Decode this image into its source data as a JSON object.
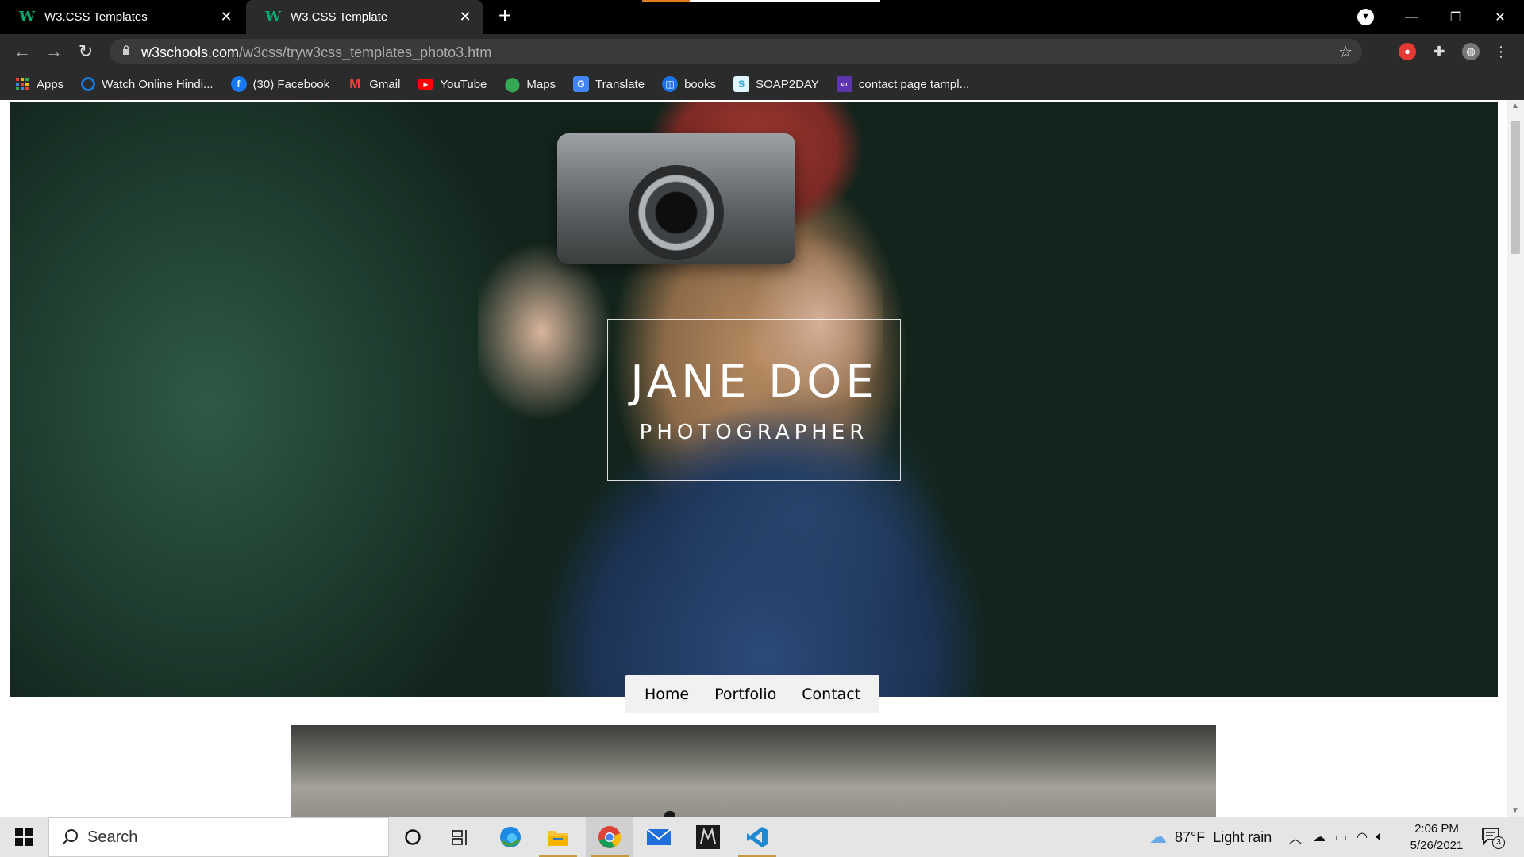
{
  "tabs": [
    {
      "label": "W3.CSS Templates",
      "favicon": "W",
      "close": "✕"
    },
    {
      "label": "W3.CSS Template",
      "favicon": "W",
      "close": "✕"
    }
  ],
  "new_tab": "+",
  "window_controls": {
    "minimize": "—",
    "restore": "❐",
    "close": "✕"
  },
  "toolbar": {
    "url_host": "w3schools.com",
    "url_path": "/w3css/tryw3css_templates_photo3.htm"
  },
  "bookmarks": [
    {
      "label": "Apps",
      "icon": "apps-grid-icon",
      "color": "#ea4335"
    },
    {
      "label": "Watch Online Hindi...",
      "icon": "circle-icon",
      "color": "#1976d2"
    },
    {
      "label": "(30) Facebook",
      "icon": "facebook-icon",
      "color": "#1877f2"
    },
    {
      "label": "Gmail",
      "icon": "gmail-icon",
      "color": "#ea4335"
    },
    {
      "label": "YouTube",
      "icon": "youtube-icon",
      "color": "#ff0000"
    },
    {
      "label": "Maps",
      "icon": "maps-icon",
      "color": "#34a853"
    },
    {
      "label": "Translate",
      "icon": "translate-icon",
      "color": "#4285f4"
    },
    {
      "label": "books",
      "icon": "books-icon",
      "color": "#1a73e8"
    },
    {
      "label": "SOAP2DAY",
      "icon": "soap2day-icon",
      "color": "#20a4d8"
    },
    {
      "label": "contact page tampl...",
      "icon": "colorlib-icon",
      "color": "#5e35b1"
    }
  ],
  "hero": {
    "name": "JANE DOE",
    "subtitle": "PHOTOGRAPHER"
  },
  "nav": {
    "home": "Home",
    "portfolio": "Portfolio",
    "contact": "Contact"
  },
  "taskbar": {
    "search_placeholder": "Search",
    "weather_temp": "87°F",
    "weather_text": "Light rain",
    "time": "2:06 PM",
    "date": "5/26/2021",
    "notification_count": "3"
  }
}
